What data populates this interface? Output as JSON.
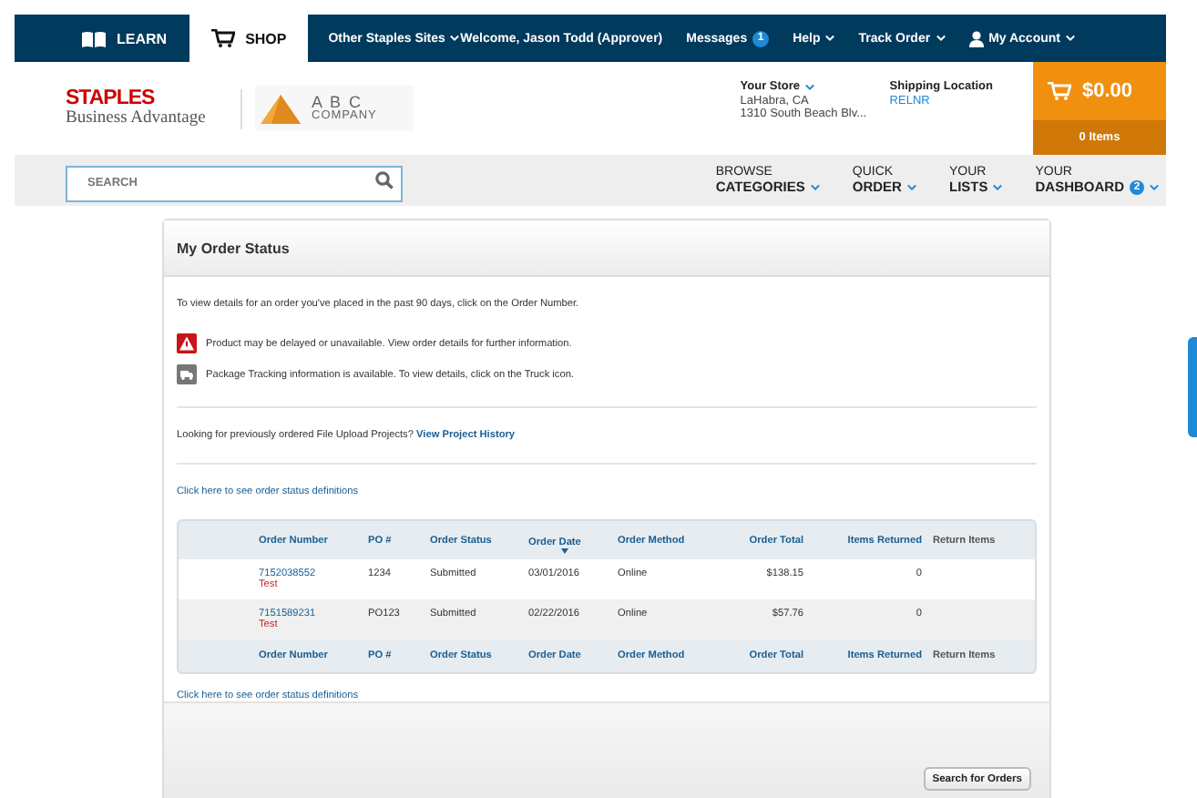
{
  "top_bar": {
    "tabs": [
      {
        "label": "LEARN",
        "kind": "book",
        "selected": false
      },
      {
        "label": "SHOP",
        "kind": "cart",
        "selected": true
      }
    ],
    "sites_menu": "Other Staples Sites",
    "welcome": "Welcome, Jason Todd (Approver)",
    "messages": {
      "label": "Messages",
      "count": "1"
    },
    "help": "Help",
    "track_order": "Track Order",
    "account": "My Account"
  },
  "header": {
    "logo": {
      "brand": "STAPLES",
      "tagline": "Business Advantage"
    },
    "company_logo": {
      "name": "A B C",
      "sub": "COMPANY"
    },
    "store": {
      "label": "Your Store",
      "city": "LaHabra, CA",
      "address": "1310 South Beach Blv..."
    },
    "shipping": {
      "label": "Shipping Location",
      "value": "RELNR"
    },
    "cart": {
      "total": "$0.00",
      "items": "0 Items"
    }
  },
  "nav": {
    "search": {
      "placeholder": "SEARCH"
    },
    "menus": [
      {
        "top": "BROWSE",
        "bottom": "CATEGORIES"
      },
      {
        "top": "QUICK",
        "bottom": "ORDER"
      },
      {
        "top": "YOUR",
        "bottom": "LISTS"
      },
      {
        "top": "YOUR",
        "bottom": "DASHBOARD",
        "badge": "2"
      }
    ]
  },
  "order_status": {
    "title": "My Order Status",
    "intro": "To view details for an order you've placed in the past 90 days, click on the Order Number.",
    "legend": [
      {
        "kind": "warning",
        "text": "Product may be delayed or unavailable. View order details for further information."
      },
      {
        "kind": "truck",
        "text": "Package Tracking information is available. To view details, click on the Truck icon."
      }
    ],
    "projects": {
      "text": "Looking for previously ordered File Upload Projects?",
      "link": "View Project History"
    },
    "definitions_link_top": "Click here to see order status definitions",
    "table": {
      "columns": [
        {
          "label": "Order Number",
          "sorted": false
        },
        {
          "label": "PO #",
          "sorted": false
        },
        {
          "label": "Order Status",
          "sorted": false
        },
        {
          "label": "Order Date",
          "sorted": true
        },
        {
          "label": "Order Method",
          "sorted": false
        },
        {
          "label": "Order Total",
          "sorted": false
        },
        {
          "label": "Items Returned",
          "sorted": false
        },
        {
          "label": "Return Items",
          "sorted": false
        }
      ],
      "rows": [
        {
          "order_number": "7152038552",
          "note": "Test",
          "po": "1234",
          "status": "Submitted",
          "date": "03/01/2016",
          "method": "Online",
          "total": "$138.15",
          "items_returned": "0"
        },
        {
          "order_number": "7151589231",
          "note": "Test",
          "po": "PO123",
          "status": "Submitted",
          "date": "02/22/2016",
          "method": "Online",
          "total": "$57.76",
          "items_returned": "0"
        }
      ],
      "footer_columns": [
        "Order Number",
        "PO #",
        "Order Status",
        "Order Date",
        "Order Method",
        "Order Total",
        "Items Returned",
        "Return Items"
      ]
    },
    "definitions_link_bottom": "Click here to see order status definitions",
    "search_button": "Search for Orders"
  }
}
